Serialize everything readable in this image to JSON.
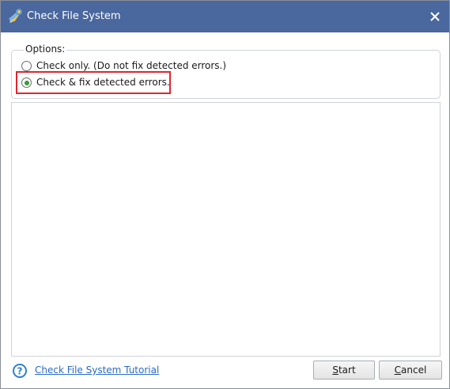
{
  "window": {
    "title": "Check File System",
    "titlebar_color": "#4a679e",
    "app_icon": "wrench-pencil-icon",
    "close_icon": "close-icon"
  },
  "options": {
    "legend": "Options:",
    "choices": [
      {
        "label": "Check only. (Do not fix detected errors.)",
        "selected": false
      },
      {
        "label": "Check & fix detected errors.",
        "selected": true
      }
    ],
    "highlight_color": "#e0262e"
  },
  "footer": {
    "help_icon": "question-icon",
    "tutorial_link": "Check File System Tutorial",
    "start_label": "Start",
    "cancel_label": "Cancel"
  }
}
